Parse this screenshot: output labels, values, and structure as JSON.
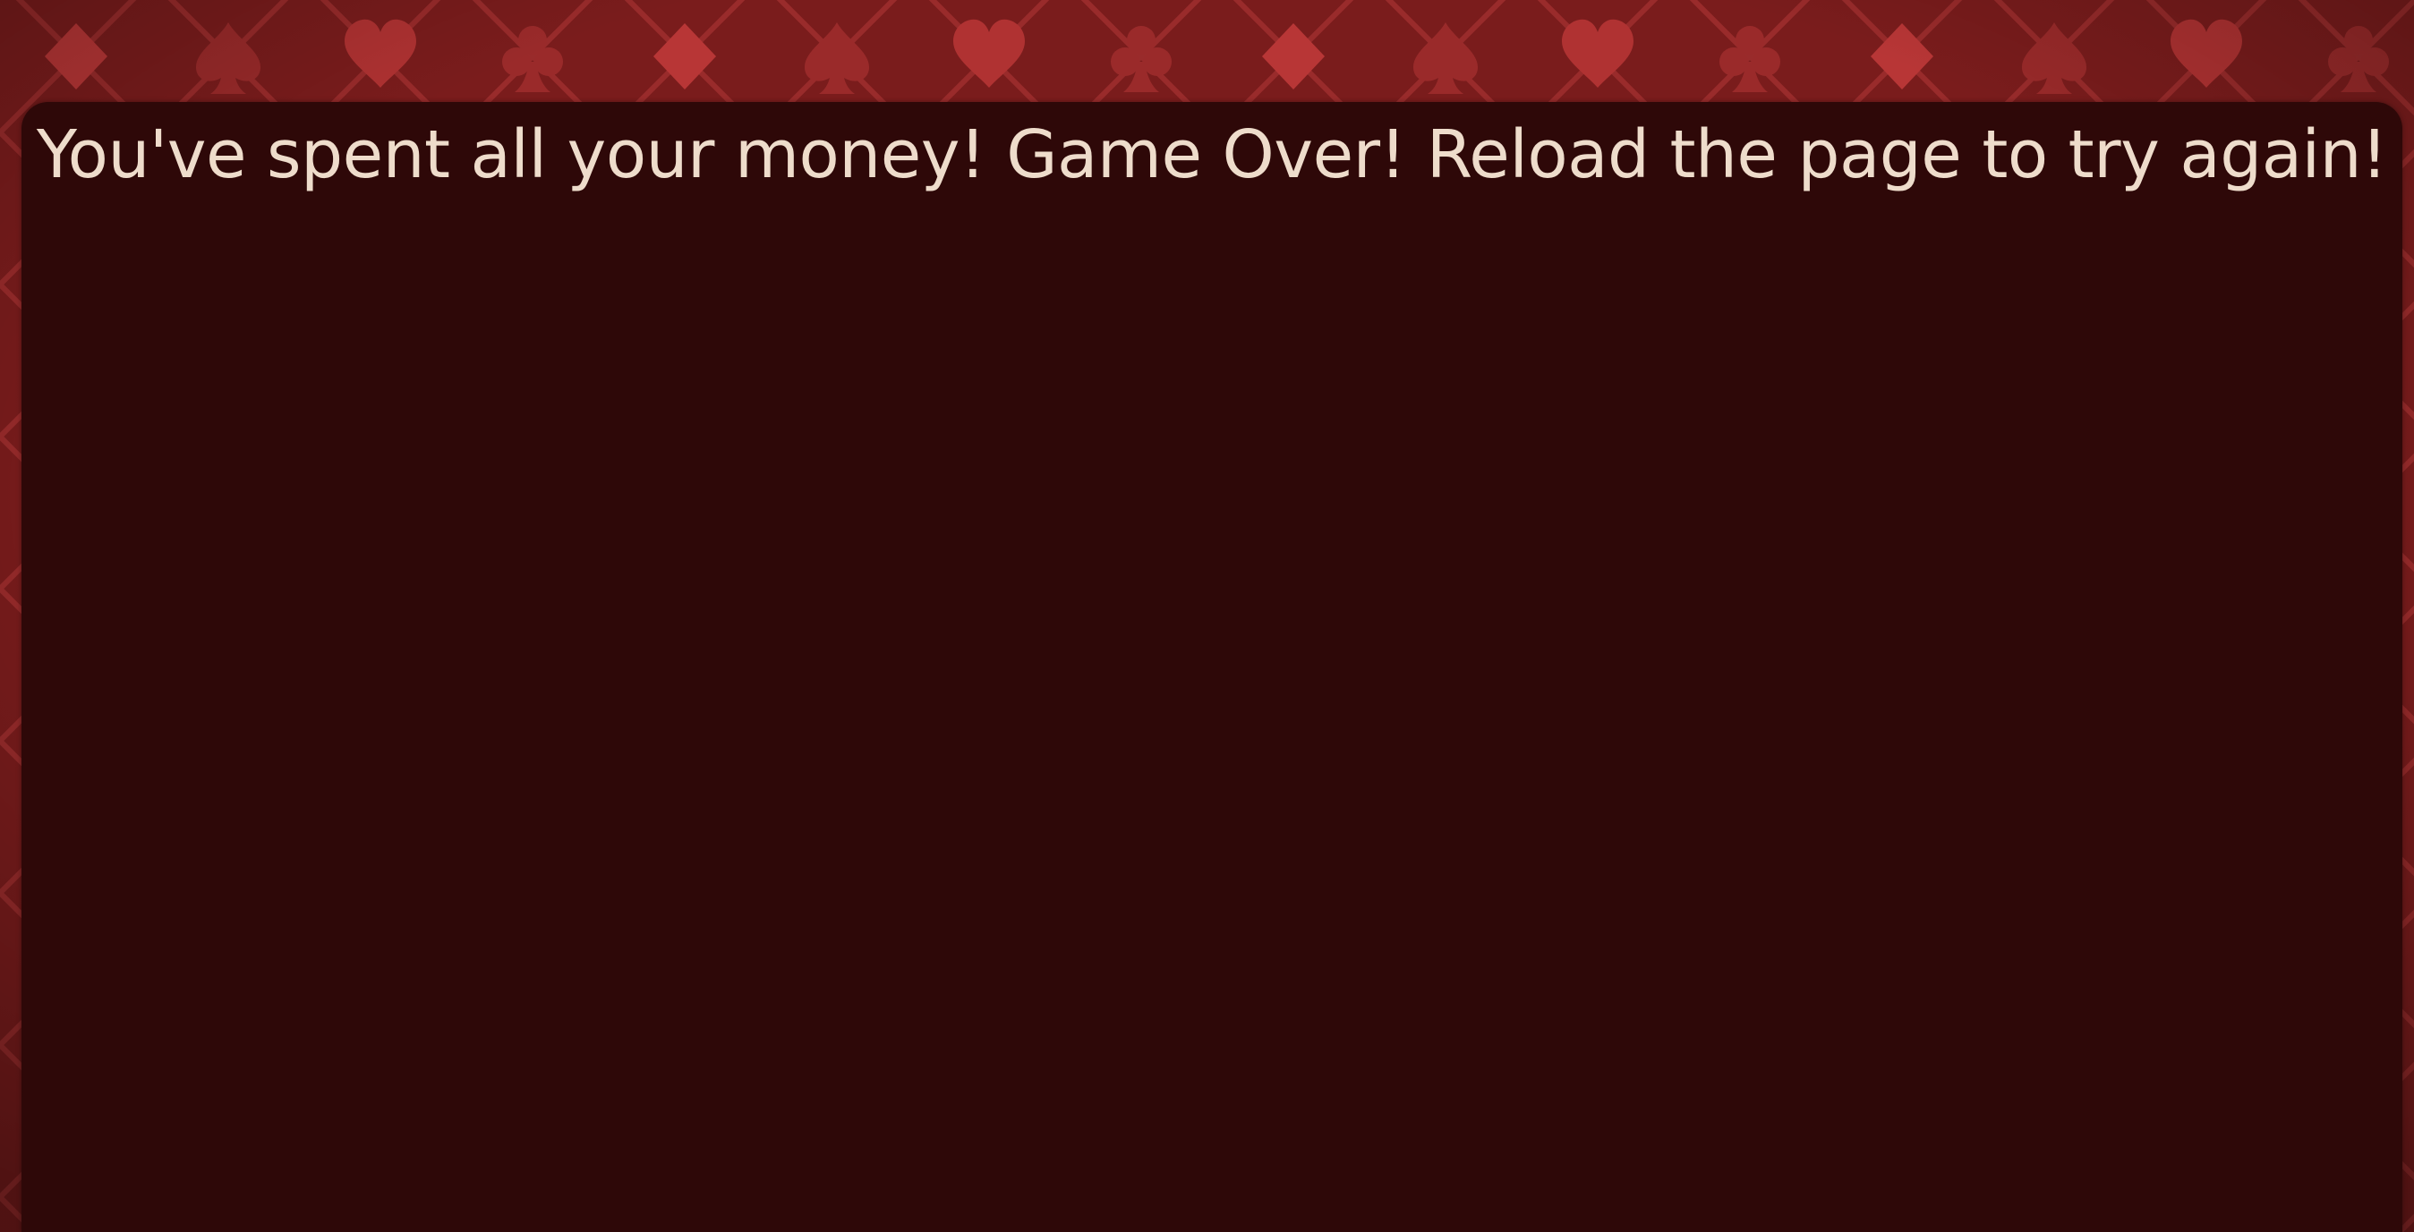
{
  "game": {
    "message": "You've spent all your money! Game Over! Reload the page to try again!"
  },
  "colors": {
    "background_felt": "#7a1c1c",
    "pattern_light": "#b43434",
    "pattern_dark": "#5e1414",
    "panel": "#2e0808",
    "text": "#eedccb"
  },
  "background": {
    "pattern_icons": [
      "diamond-suit-icon",
      "spade-suit-icon",
      "heart-suit-icon",
      "club-suit-icon"
    ]
  }
}
